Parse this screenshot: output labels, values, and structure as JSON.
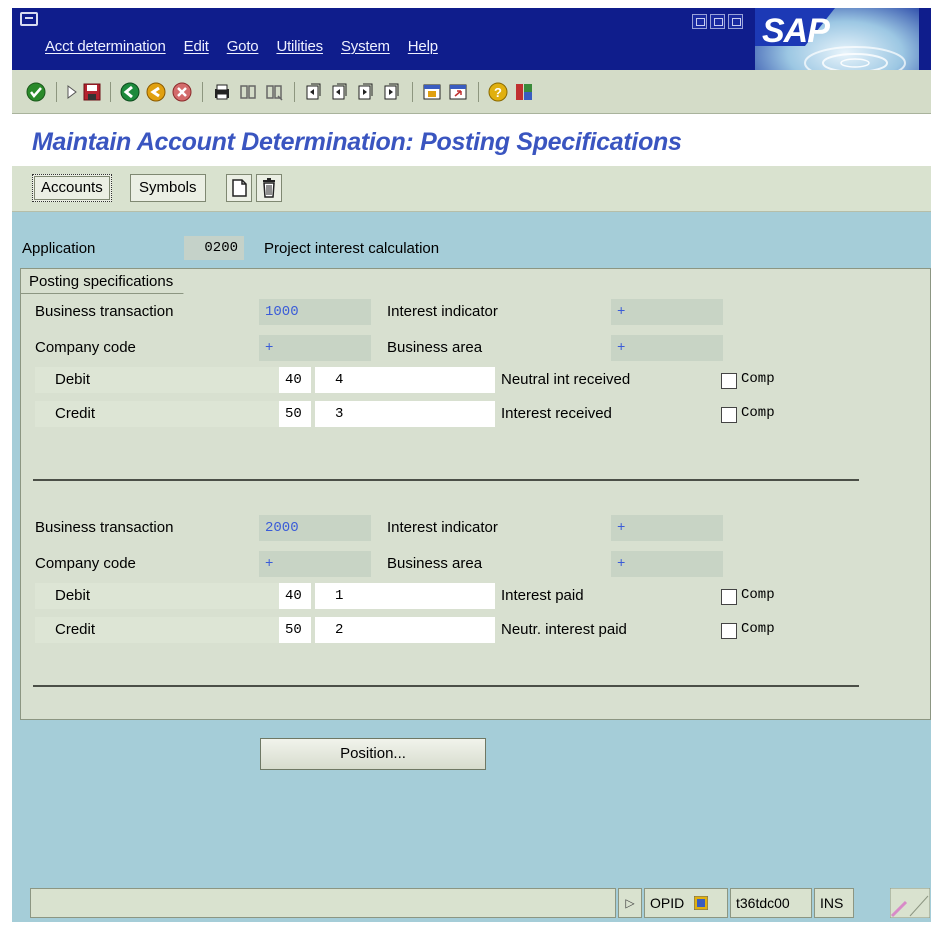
{
  "menubar": {
    "items": [
      "Acct determination",
      "Edit",
      "Goto",
      "Utilities",
      "System",
      "Help"
    ],
    "logo": "SAP"
  },
  "page": {
    "title": "Maintain Account Determination: Posting Specifications"
  },
  "app_toolbar": {
    "accounts_label": "Accounts",
    "symbols_label": "Symbols"
  },
  "header": {
    "application_label": "Application",
    "application_code": "0200",
    "application_desc": "Project interest calculation"
  },
  "group": {
    "title": "Posting specifications",
    "blocks": [
      {
        "bt_label": "Business transaction",
        "bt_value": "1000",
        "ii_label": "Interest indicator",
        "ii_value": "+",
        "cc_label": "Company code",
        "cc_value": "+",
        "ba_label": "Business area",
        "ba_value": "+",
        "rows": [
          {
            "label": "Debit",
            "key": "40",
            "symbol": "4",
            "desc": "Neutral int received",
            "comp_label": "Comp",
            "comp_checked": false
          },
          {
            "label": "Credit",
            "key": "50",
            "symbol": "3",
            "desc": "Interest received",
            "comp_label": "Comp",
            "comp_checked": false
          }
        ]
      },
      {
        "bt_label": "Business transaction",
        "bt_value": "2000",
        "ii_label": "Interest indicator",
        "ii_value": "+",
        "cc_label": "Company code",
        "cc_value": "+",
        "ba_label": "Business area",
        "ba_value": "+",
        "rows": [
          {
            "label": "Debit",
            "key": "40",
            "symbol": "1",
            "desc": "Interest paid",
            "comp_label": "Comp",
            "comp_checked": false
          },
          {
            "label": "Credit",
            "key": "50",
            "symbol": "2",
            "desc": "Neutr. interest paid",
            "comp_label": "Comp",
            "comp_checked": false
          }
        ]
      }
    ]
  },
  "buttons": {
    "position_label": "Position..."
  },
  "statusbar": {
    "program": "OPID",
    "server": "t36tdc00",
    "mode": "INS"
  },
  "colors": {
    "menubar": "#0f1d8c",
    "title": "#3a55c0",
    "workarea": "#a5cdd8",
    "group": "#d8e0d0"
  }
}
